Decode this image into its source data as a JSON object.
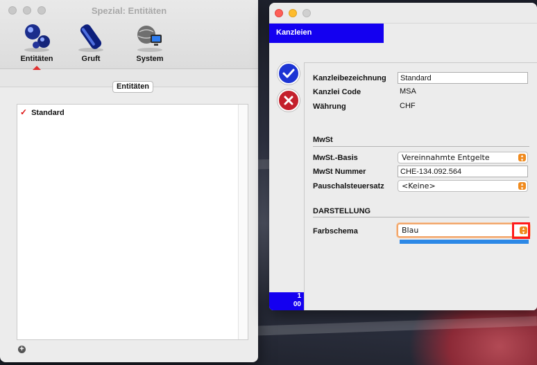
{
  "left_window": {
    "title": "Spezial: Entitäten",
    "toolbar": [
      {
        "label": "Entitäten",
        "icon": "entities-icon",
        "active": true
      },
      {
        "label": "Gruft",
        "icon": "vault-icon"
      },
      {
        "label": "System",
        "icon": "system-icon"
      }
    ],
    "section_button": "Entitäten",
    "list": [
      {
        "label": "Standard",
        "checked": true
      }
    ],
    "add_button": "+"
  },
  "right_window": {
    "header": "Kanzleien",
    "footer_counter": [
      "1",
      "00"
    ],
    "fields": {
      "kanzleibezeichnung": {
        "label": "Kanzleibezeichnung",
        "value": "Standard"
      },
      "kanzlei_code": {
        "label": "Kanzlei Code",
        "value": "MSA"
      },
      "waehrung": {
        "label": "Währung",
        "value": "CHF"
      }
    },
    "mwst": {
      "heading": "MwSt",
      "basis": {
        "label": "MwSt.-Basis",
        "value": "Vereinnahmte Entgelte"
      },
      "nummer": {
        "label": "MwSt Nummer",
        "value": "CHE-134.092.564"
      },
      "pauschal": {
        "label": "Pauschalsteuersatz",
        "value": "<Keine>"
      }
    },
    "darstellung": {
      "heading": "DARSTELLUNG",
      "farbschema": {
        "label": "Farbschema",
        "value": "Blau"
      }
    }
  },
  "colors": {
    "header_blue": "#1400f0",
    "confirm_blue": "#1c34d4",
    "cancel_red": "#c4202c",
    "stepper_orange": "#f08a1d",
    "scheme_bar": "#2c88e6",
    "highlight": "#ff1a1a"
  }
}
